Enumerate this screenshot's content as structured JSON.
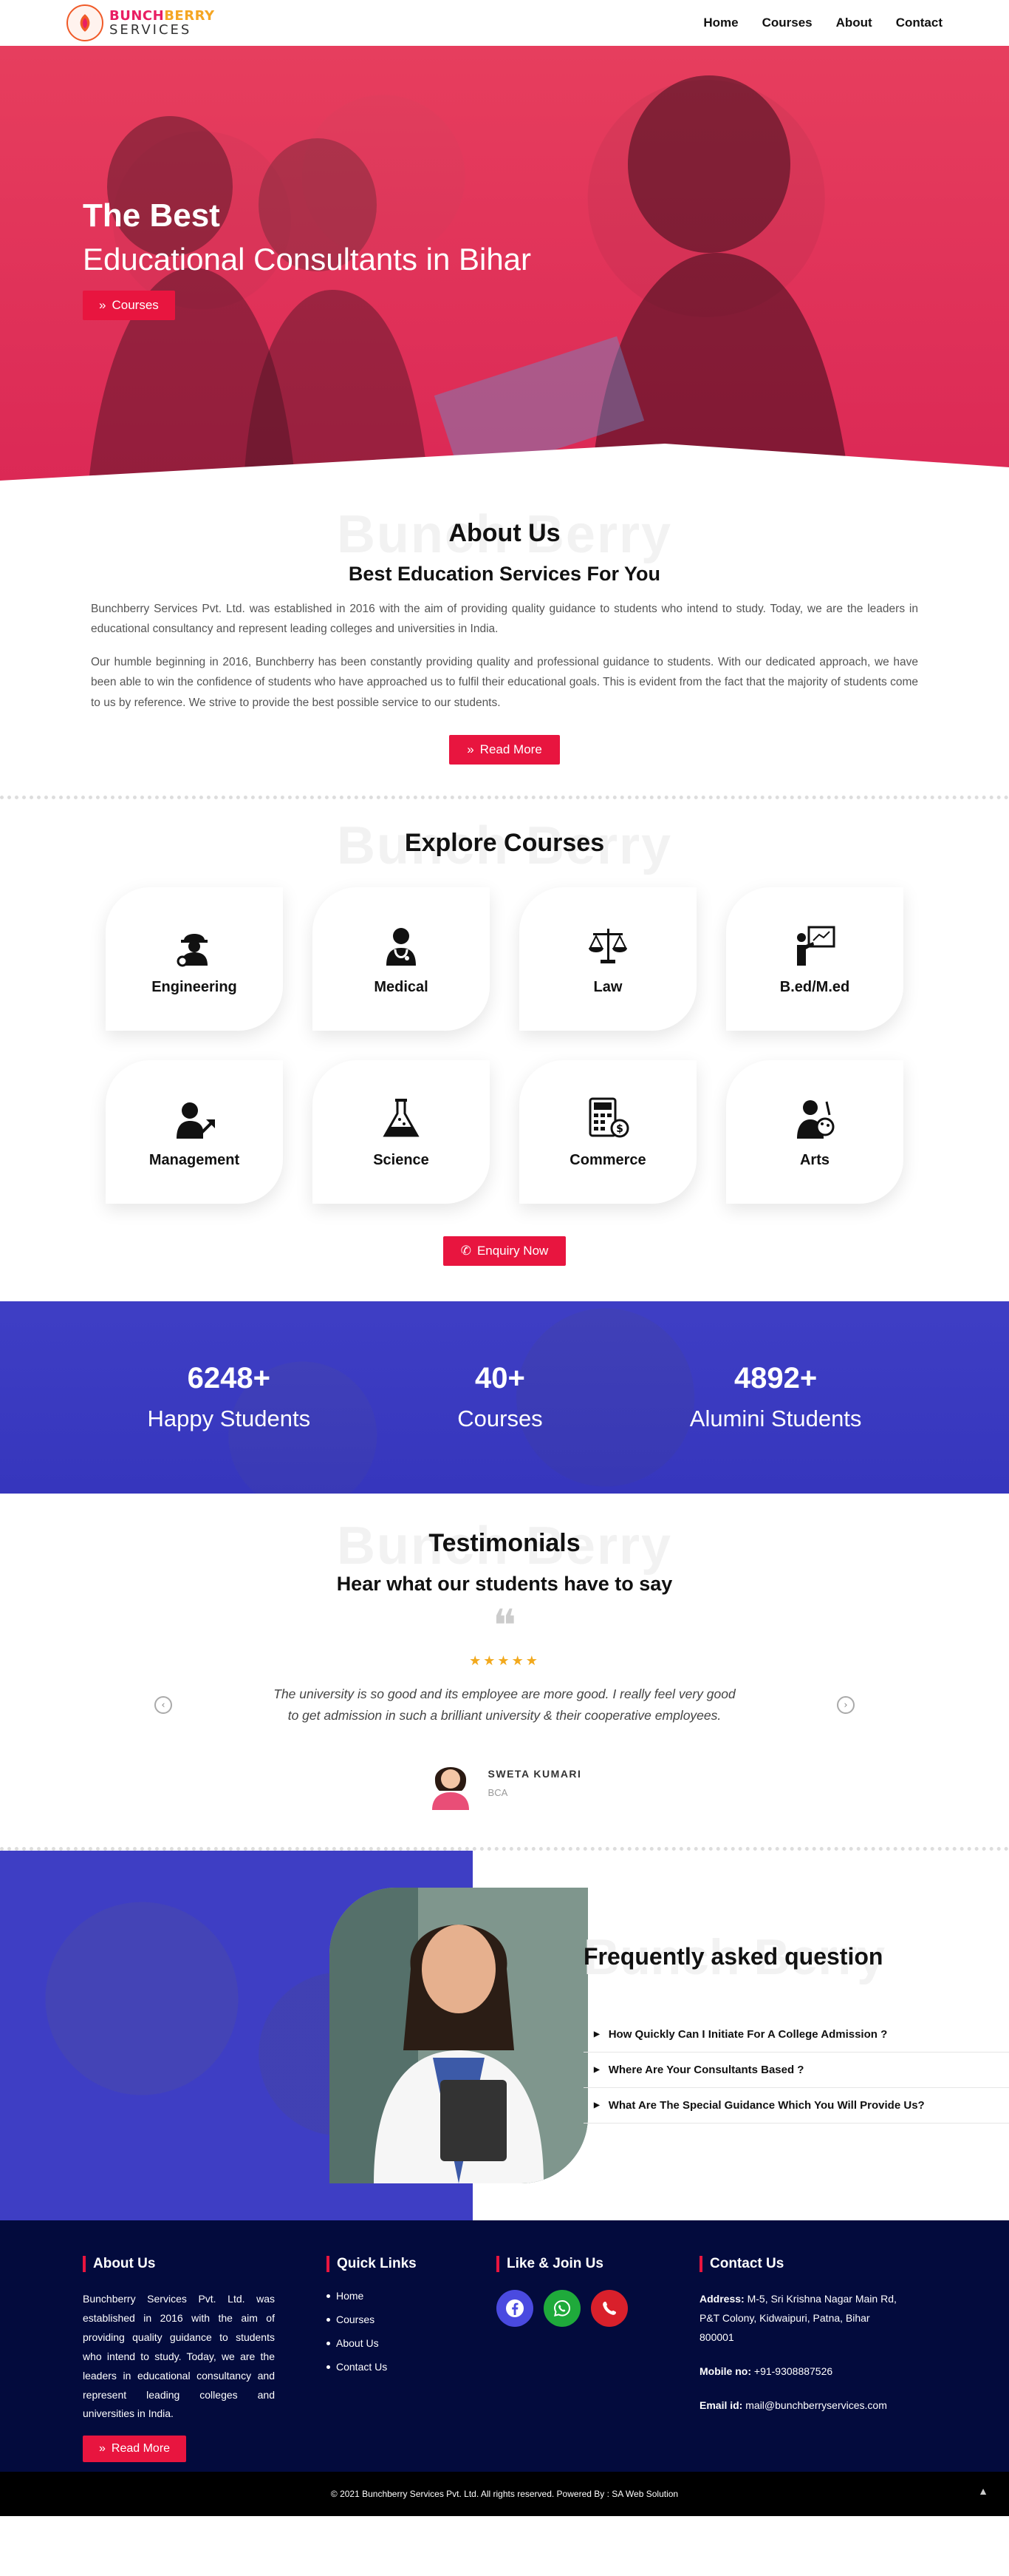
{
  "brand": {
    "name_top_a": "BUNCH",
    "name_top_b": "BERRY",
    "name_bottom": "SERVICES"
  },
  "nav": {
    "items": [
      {
        "label": "Home"
      },
      {
        "label": "Courses"
      },
      {
        "label": "About"
      },
      {
        "label": "Contact"
      }
    ]
  },
  "hero": {
    "line1": "The Best",
    "line2": "Educational Consultants in Bihar",
    "button": "Courses"
  },
  "ghost_text": "Bunch Berry",
  "about": {
    "title": "About Us",
    "subtitle": "Best Education Services For You",
    "para1": "Bunchberry Services Pvt. Ltd. was established in 2016 with the aim of providing quality guidance to students who intend to study. Today, we are the leaders in educational consultancy and represent leading colleges and universities in India.",
    "para2": "Our humble beginning in 2016, Bunchberry has been constantly providing quality and professional guidance to students. With our dedicated approach, we have been able to win the confidence of students who have approached us to fulfil their educational goals. This is evident from the fact that the majority of students come to us by reference. We strive to provide the best possible service to our students.",
    "button": "Read More"
  },
  "courses": {
    "title": "Explore Courses",
    "items": [
      {
        "label": "Engineering",
        "icon": "engineer-icon"
      },
      {
        "label": "Medical",
        "icon": "doctor-icon"
      },
      {
        "label": "Law",
        "icon": "scales-icon"
      },
      {
        "label": "B.ed/M.ed",
        "icon": "teacher-board-icon"
      },
      {
        "label": "Management",
        "icon": "manager-growth-icon"
      },
      {
        "label": "Science",
        "icon": "flask-icon"
      },
      {
        "label": "Commerce",
        "icon": "calculator-icon"
      },
      {
        "label": "Arts",
        "icon": "artist-icon"
      }
    ],
    "button": "Enquiry Now"
  },
  "stats": [
    {
      "num": "6248+",
      "label": "Happy Students"
    },
    {
      "num": "40+",
      "label": "Courses"
    },
    {
      "num": "4892+",
      "label": "Alumini Students"
    }
  ],
  "testimonials": {
    "title": "Testimonials",
    "subtitle": "Hear what our students have to say",
    "rating": 5,
    "text": "The university is so good and its employee are more good. I really feel very good to get admission in such a brilliant university & their cooperative employees.",
    "name": "SWETA KUMARI",
    "course": "BCA"
  },
  "faq": {
    "title": "Frequently asked question",
    "items": [
      {
        "q": "How Quickly Can I Initiate For A College Admission ?"
      },
      {
        "q": "Where Are Your Consultants Based ?"
      },
      {
        "q": "What Are The Special Guidance Which You Will Provide Us?"
      }
    ]
  },
  "footer": {
    "about_title": "About Us",
    "about_text": "Bunchberry Services Pvt. Ltd. was established in 2016 with the aim of providing quality guidance to students who intend to study. Today, we are the leaders in educational consultancy and represent leading colleges and universities in India.",
    "about_button": "Read More",
    "links_title": "Quick Links",
    "links": [
      {
        "label": "Home"
      },
      {
        "label": "Courses"
      },
      {
        "label": "About Us"
      },
      {
        "label": "Contact Us"
      }
    ],
    "social_title": "Like & Join Us",
    "socials": [
      {
        "icon": "facebook-icon",
        "color": "#4a4ae0"
      },
      {
        "icon": "whatsapp-icon",
        "color": "#1faa3b"
      },
      {
        "icon": "phone-icon",
        "color": "#d9202b"
      }
    ],
    "contact_title": "Contact Us",
    "address_label": "Address:",
    "address": "M-5, Sri Krishna Nagar Main Rd, P&T Colony, Kidwaipuri, Patna, Bihar 800001",
    "mobile_label": "Mobile no:",
    "mobile": "+91-9308887526",
    "email_label": "Email id:",
    "email": "mail@bunchberryservices.com",
    "copyright": "© 2021 Bunchberry Services Pvt. Ltd. All rights reserved. Powered By : SA Web Solution"
  },
  "colors": {
    "accent": "#e8153f",
    "hero_overlay": "#ec4060",
    "stats_overlay": "#4040c8",
    "footer_bg": "#030b3d"
  }
}
